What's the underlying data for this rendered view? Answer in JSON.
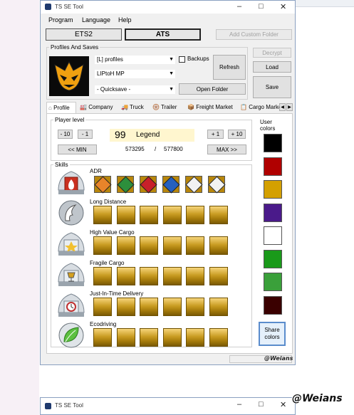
{
  "window": {
    "title": "TS SE Tool",
    "minimize": "–",
    "maximize": "□",
    "close": "✕"
  },
  "menu": [
    "Program",
    "Language",
    "Help"
  ],
  "games": {
    "ets2": "ETS2",
    "ats": "ATS",
    "add_custom": "Add Custom Folder"
  },
  "profiles": {
    "group_label": "Profiles And Saves",
    "profile_list": "[L] profiles",
    "backups_label": "Backups",
    "profile": "LIPtoH MP",
    "save": "- Quicksave -",
    "refresh": "Refresh",
    "open_folder": "Open Folder",
    "decrypt": "Decrypt",
    "load": "Load",
    "save_button": "Save"
  },
  "tabs": [
    "Profile",
    "Company",
    "Truck",
    "Trailer",
    "Freight Market",
    "Cargo Marke"
  ],
  "player_level": {
    "label": "Player level",
    "minus10": "- 10",
    "minus1": "- 1",
    "plus1": "+ 1",
    "plus10": "+ 10",
    "min": "<< MIN",
    "max": "MAX >>",
    "level": "99",
    "rank": "Legend",
    "xp_current": "573295",
    "xp_sep": "/",
    "xp_max": "577800"
  },
  "skills": {
    "label": "Skills",
    "items": [
      {
        "name": "ADR",
        "level": 6
      },
      {
        "name": "Long Distance",
        "level": 6
      },
      {
        "name": "High Value Cargo",
        "level": 6
      },
      {
        "name": "Fragile Cargo",
        "level": 6
      },
      {
        "name": "Just-In-Time Delivery",
        "level": 6
      },
      {
        "name": "Ecodriving",
        "level": 6
      }
    ],
    "adr_colors": [
      "#e8842a",
      "#2d8f3c",
      "#c8202a",
      "#2560c0",
      "#f2f2f2",
      "#f2f2f2"
    ]
  },
  "user_colors": {
    "label": "User colors",
    "colors": [
      "#000000",
      "#b00000",
      "#d4a000",
      "#4a1a8a",
      "#ffffff",
      "#1a9a1a",
      "#3aa03a",
      "#3a0000"
    ],
    "share": "Share colors"
  },
  "watermark": "@Weians",
  "watermark_big": "@Weians",
  "second_window": {
    "title": "TS SE Tool"
  }
}
